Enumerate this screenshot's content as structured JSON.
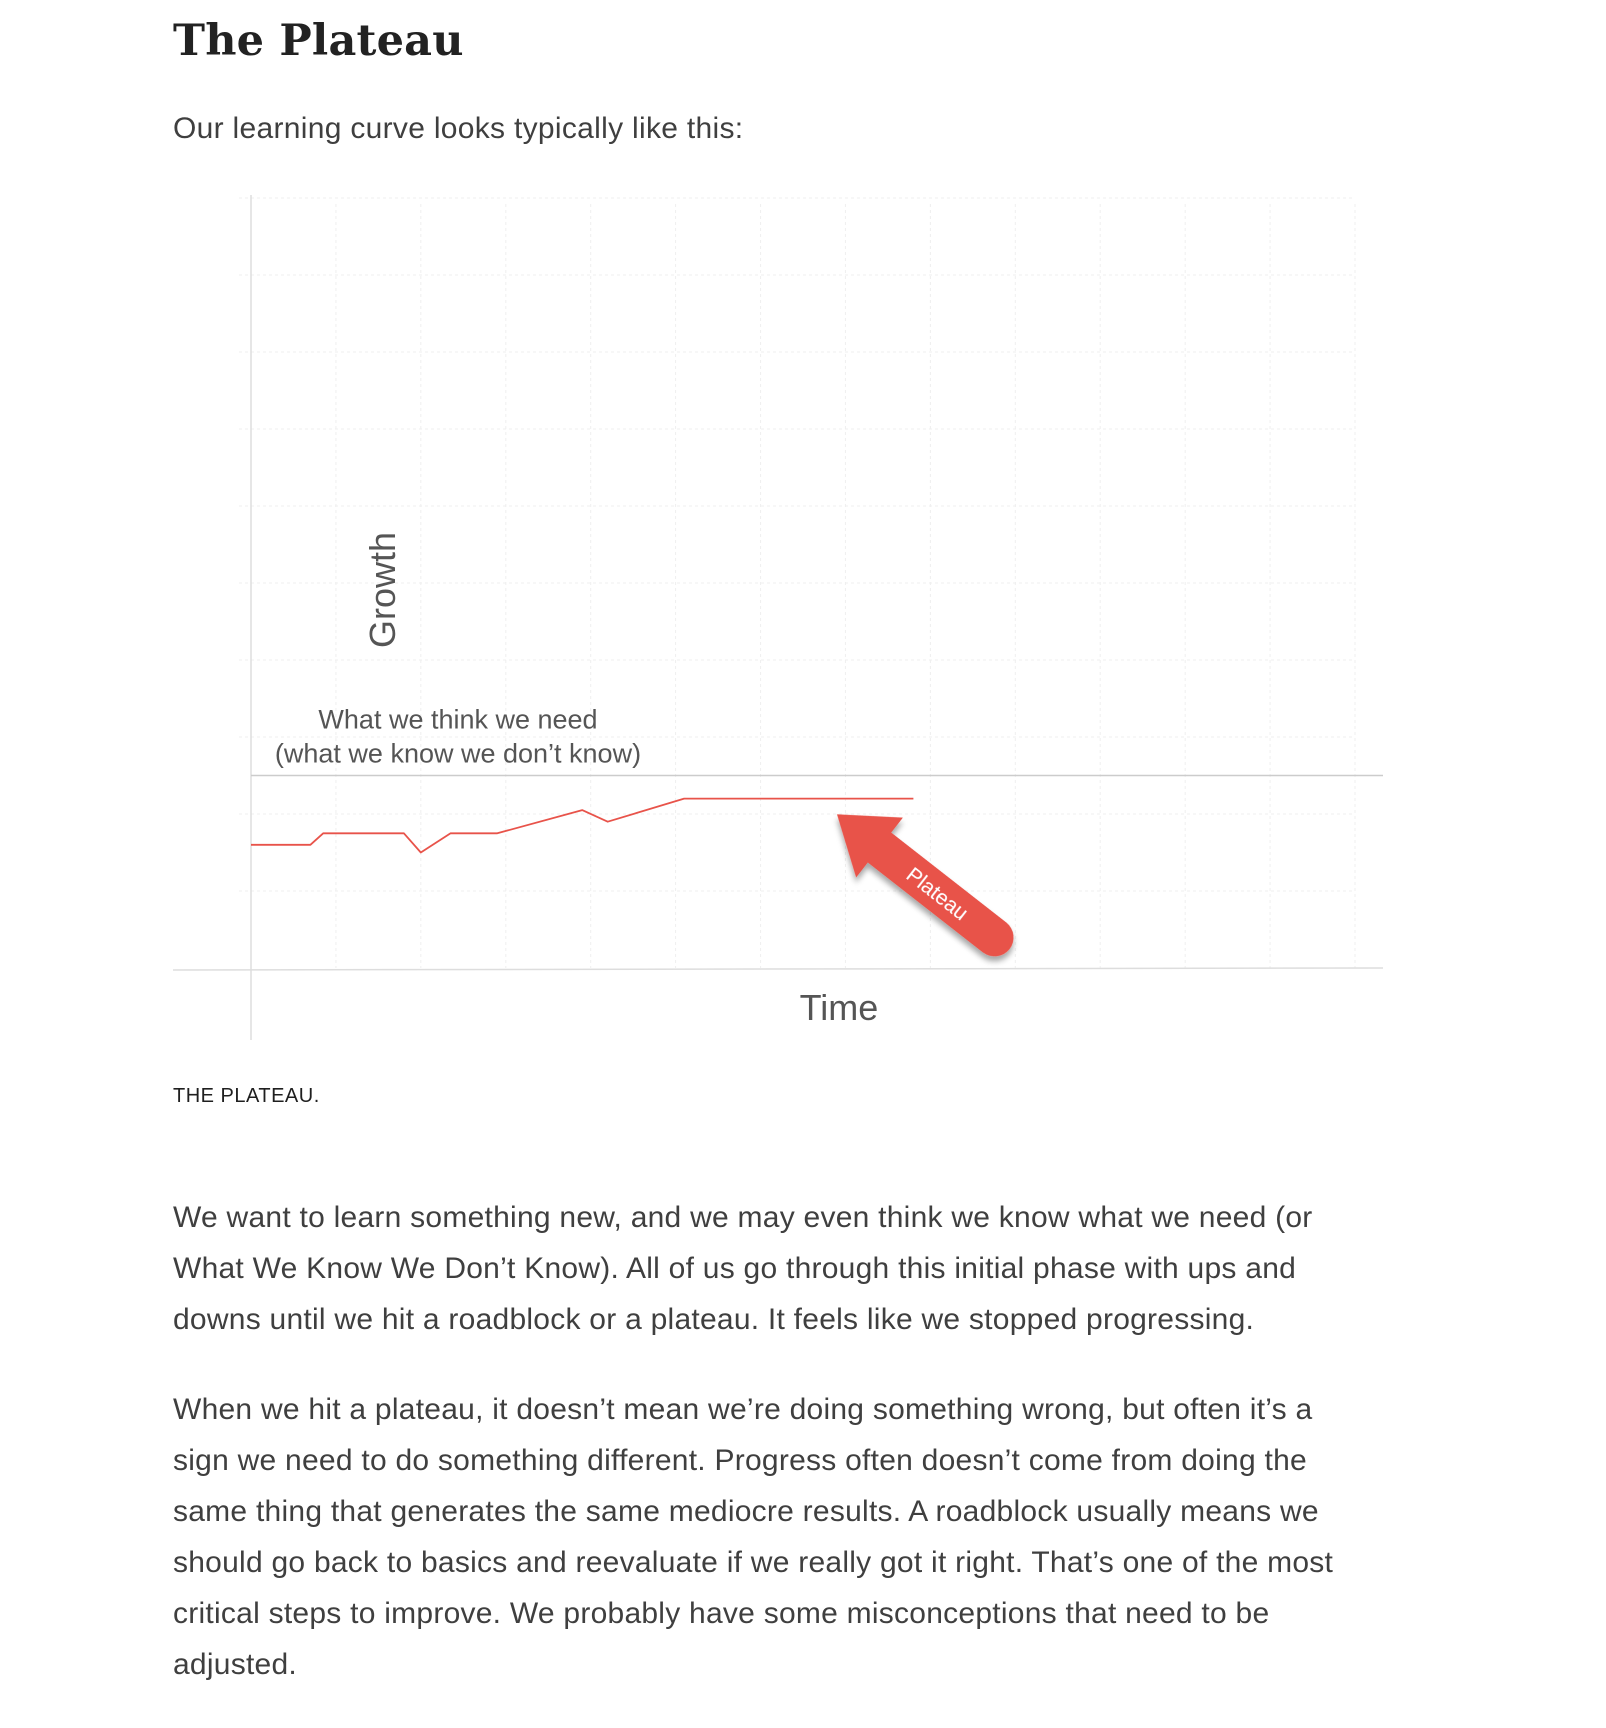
{
  "article": {
    "title": "The Plateau",
    "intro": "Our learning curve looks typically like this:",
    "caption": "THE PLATEAU.",
    "paragraphs": [
      [
        "We want to learn something new, and we may even think we know what we need (or",
        "What We Know We Don’t Know). All of us go through this initial phase with ups and",
        "downs until we hit a roadblock or a plateau. It feels like we stopped progressing."
      ],
      [
        "When we hit a plateau, it doesn’t mean we’re doing something wrong, but often it’s a",
        "sign we need to do something different. Progress often doesn’t come from doing the",
        "same thing that generates the same mediocre results. A roadblock usually means we",
        "should go back to basics and reevaluate if we really got it right. That’s one of the most",
        "critical steps to improve. We probably have some misconceptions that need to be",
        "adjusted."
      ]
    ]
  },
  "chart_data": {
    "type": "line",
    "xlabel": "Time",
    "ylabel": "Growth",
    "xlim": [
      0,
      13
    ],
    "ylim": [
      0,
      10
    ],
    "grid": true,
    "series": [
      {
        "color": "#e8534a",
        "x": [
          0,
          0.7,
          0.85,
          1.8,
          2.0,
          2.35,
          2.9,
          3.9,
          4.2,
          5.1,
          7.8
        ],
        "y": [
          1.6,
          1.6,
          1.75,
          1.75,
          1.5,
          1.75,
          1.75,
          2.05,
          1.9,
          2.2,
          2.2
        ]
      }
    ],
    "reference_line": {
      "y": 2.5,
      "color": "#cccccc",
      "label": [
        "What we think we need",
        "(what we know we don’t know)"
      ]
    },
    "annotation": {
      "text": "Plateau",
      "color": "#e8534a",
      "target": [
        6.9,
        2.1
      ]
    }
  }
}
